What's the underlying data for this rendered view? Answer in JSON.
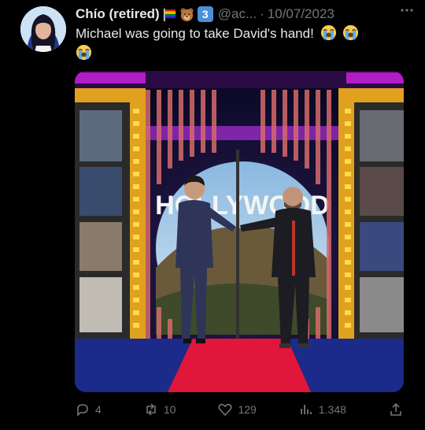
{
  "tweet": {
    "display_name": "Chío (retired)",
    "handle": "@ac...",
    "separator": "·",
    "date": "10/07/2023",
    "text": "Michael was going to take David's hand!",
    "name_emojis": [
      "rainbow-flag-emoji",
      "bear-emoji",
      "keycap-3-emoji"
    ],
    "keycap_label": "3",
    "text_emojis": [
      "loudly-crying-face-emoji",
      "loudly-crying-face-emoji",
      "loudly-crying-face-emoji"
    ]
  },
  "media": {
    "sign_text": "HOLLYWOOD",
    "colors": {
      "stage_purple": "#b21cc4",
      "carpet_red": "#e0163a",
      "backdrop": "#0b0b2a"
    }
  },
  "actions": {
    "replies": "4",
    "retweets": "10",
    "likes": "129",
    "views": "1.348"
  },
  "icons": [
    "more-icon",
    "reply-icon",
    "retweet-icon",
    "like-icon",
    "views-icon",
    "share-icon"
  ]
}
